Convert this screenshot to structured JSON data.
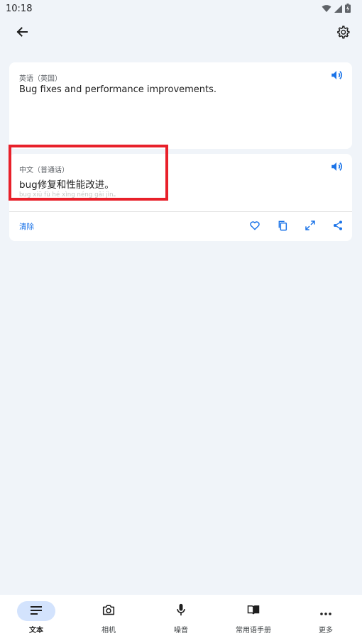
{
  "status": {
    "time": "10:18"
  },
  "source": {
    "language": "英语（英国）",
    "text": "Bug fixes and performance improvements."
  },
  "target": {
    "language": "中文（普通话）",
    "text": "bug修复和性能改进。",
    "pinyin": "bug xiū fù hé xìng néng gǎi jìn。",
    "clear_label": "清除"
  },
  "bottom_nav": {
    "items": [
      {
        "label": "文本",
        "icon": "text-lines-icon",
        "active": true
      },
      {
        "label": "相机",
        "icon": "camera-icon",
        "active": false
      },
      {
        "label": "噪音",
        "icon": "microphone-icon",
        "active": false
      },
      {
        "label": "常用语手册",
        "icon": "phrasebook-icon",
        "active": false
      },
      {
        "label": "更多",
        "icon": "more-horizontal-icon",
        "active": false
      }
    ]
  },
  "colors": {
    "accent": "#1a73e8",
    "active_pill": "#d3e3fd",
    "highlight": "#e8202a",
    "background": "#f0f4f9"
  }
}
